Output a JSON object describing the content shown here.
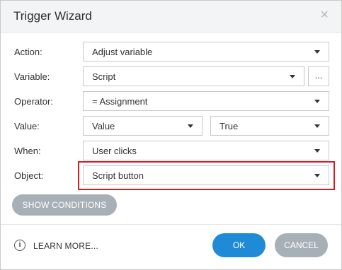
{
  "dialog": {
    "title": "Trigger Wizard",
    "close_glyph": "×"
  },
  "form": {
    "action": {
      "label": "Action:",
      "value": "Adjust variable"
    },
    "variable": {
      "label": "Variable:",
      "value": "Script",
      "browse_label": "..."
    },
    "operator": {
      "label": "Operator:",
      "value": "= Assignment"
    },
    "value": {
      "label": "Value:",
      "type_value": "Value",
      "value": "True"
    },
    "when": {
      "label": "When:",
      "value": "User clicks"
    },
    "object": {
      "label": "Object:",
      "value": "Script button",
      "highlight_color": "#d11f2a"
    }
  },
  "buttons": {
    "show_conditions": "SHOW CONDITIONS",
    "learn_more": "LEARN MORE...",
    "ok": "OK",
    "cancel": "CANCEL"
  },
  "icons": {
    "info": "info-circle-icon",
    "close": "close-icon",
    "caret": "chevron-down-icon"
  },
  "colors": {
    "primary": "#1f8ad6",
    "secondary": "#a7b0b7",
    "highlight": "#d11f2a"
  }
}
